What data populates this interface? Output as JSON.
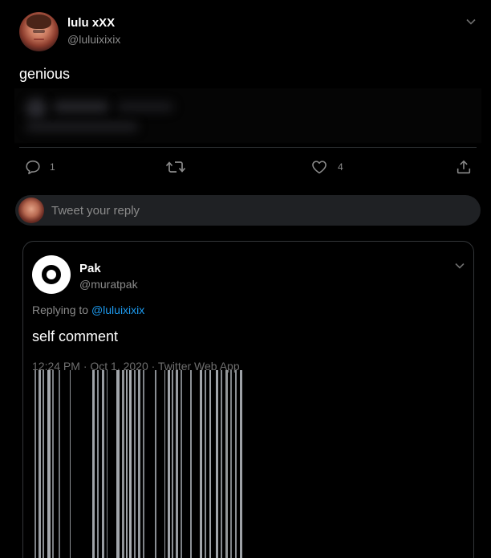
{
  "tweet": {
    "author_name": "lulu xXX",
    "author_handle": "@luluixixix",
    "text": "genious",
    "actions": {
      "reply_count": "1",
      "retweet_count": "",
      "like_count": "4"
    }
  },
  "reply_box": {
    "placeholder": "Tweet your reply"
  },
  "quoted_tweet": {
    "author_name": "Pak",
    "author_handle": "@muratpak",
    "replying_prefix": "Replying to ",
    "replying_to": "@luluixixix",
    "text": "self comment",
    "meta": "12:24 PM · Oct 1, 2020 · Twitter Web App"
  },
  "icons": {
    "reply": "comment-icon",
    "retweet": "retweet-icon",
    "like": "heart-icon",
    "share": "share-icon",
    "more": "chevron-down-icon"
  },
  "colors": {
    "background": "#000000",
    "text_primary": "#ffffff",
    "text_secondary": "#8b8b8b",
    "link": "#1d9bf0",
    "reply_box": "#1f2124",
    "border": "#333639"
  }
}
